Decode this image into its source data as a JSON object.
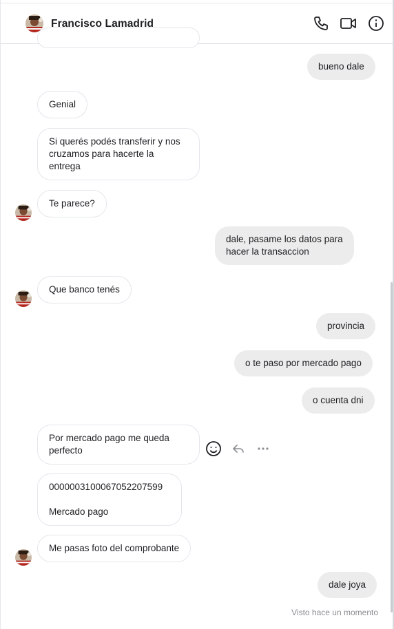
{
  "header": {
    "contact_name": "Francisco Lamadrid",
    "avatar_icon": "contact-avatar-icon",
    "icons": [
      "phone-icon",
      "video-camera-icon",
      "info-icon"
    ]
  },
  "messages": [
    {
      "side": "out",
      "text": "bueno dale"
    },
    {
      "side": "in",
      "text": "Genial"
    },
    {
      "side": "in",
      "text": "Si querés podés transferir y nos\ncruzamos para hacerte la\nentrega"
    },
    {
      "side": "in",
      "text": "Te parece?"
    },
    {
      "side": "out",
      "text": "dale, pasame los datos para\nhacer la transaccion"
    },
    {
      "side": "in",
      "text": "Que banco tenés"
    },
    {
      "side": "out",
      "text": "provincia"
    },
    {
      "side": "out",
      "text": "o te paso por mercado pago"
    },
    {
      "side": "out",
      "text": "o cuenta dni"
    },
    {
      "side": "in",
      "text": "Por mercado pago me queda\nperfecto"
    },
    {
      "side": "in",
      "text": "0000003100067052207599\n\nMercado pago"
    },
    {
      "side": "in",
      "text": "Me pasas foto del comprobante"
    },
    {
      "side": "out",
      "text": "dale joya"
    }
  ],
  "message_actions": [
    "emoji-reaction-icon",
    "reply-icon",
    "more-options-icon"
  ],
  "status": {
    "seen_label": "Visto hace un momento"
  },
  "colors": {
    "incoming_bubble": "#ffffff",
    "outgoing_bubble": "#ececec",
    "border": "#e4e6eb",
    "muted_text": "#8a8d91"
  }
}
